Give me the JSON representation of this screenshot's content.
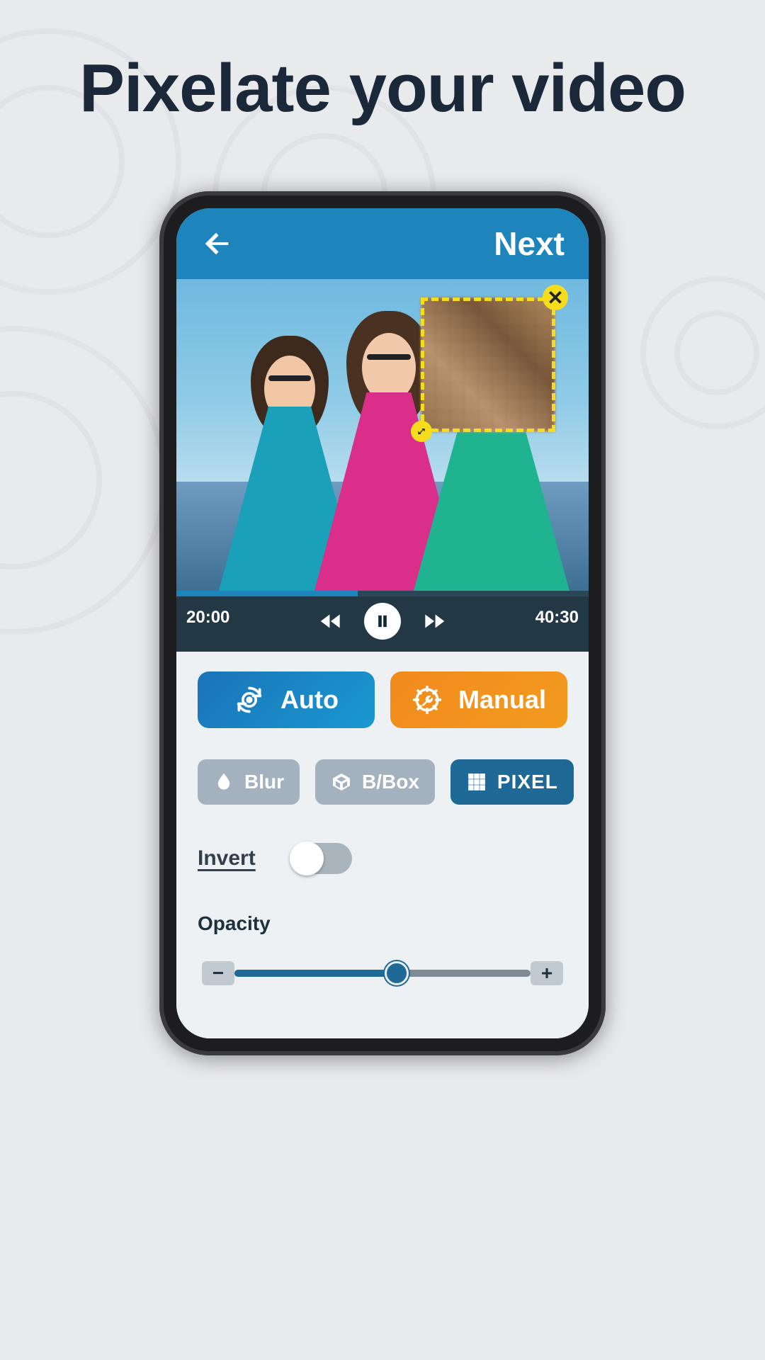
{
  "page": {
    "title": "Pixelate your video"
  },
  "header": {
    "next_label": "Next"
  },
  "playback": {
    "time_elapsed": "20:00",
    "time_total": "40:30"
  },
  "modes": {
    "auto_label": "Auto",
    "manual_label": "Manual"
  },
  "effects": {
    "blur_label": "Blur",
    "bbox_label": "B/Box",
    "pixel_label": "PIXEL"
  },
  "invert": {
    "label": "Invert",
    "value": false
  },
  "opacity": {
    "label": "Opacity",
    "minus_symbol": "−",
    "plus_symbol": "+"
  }
}
